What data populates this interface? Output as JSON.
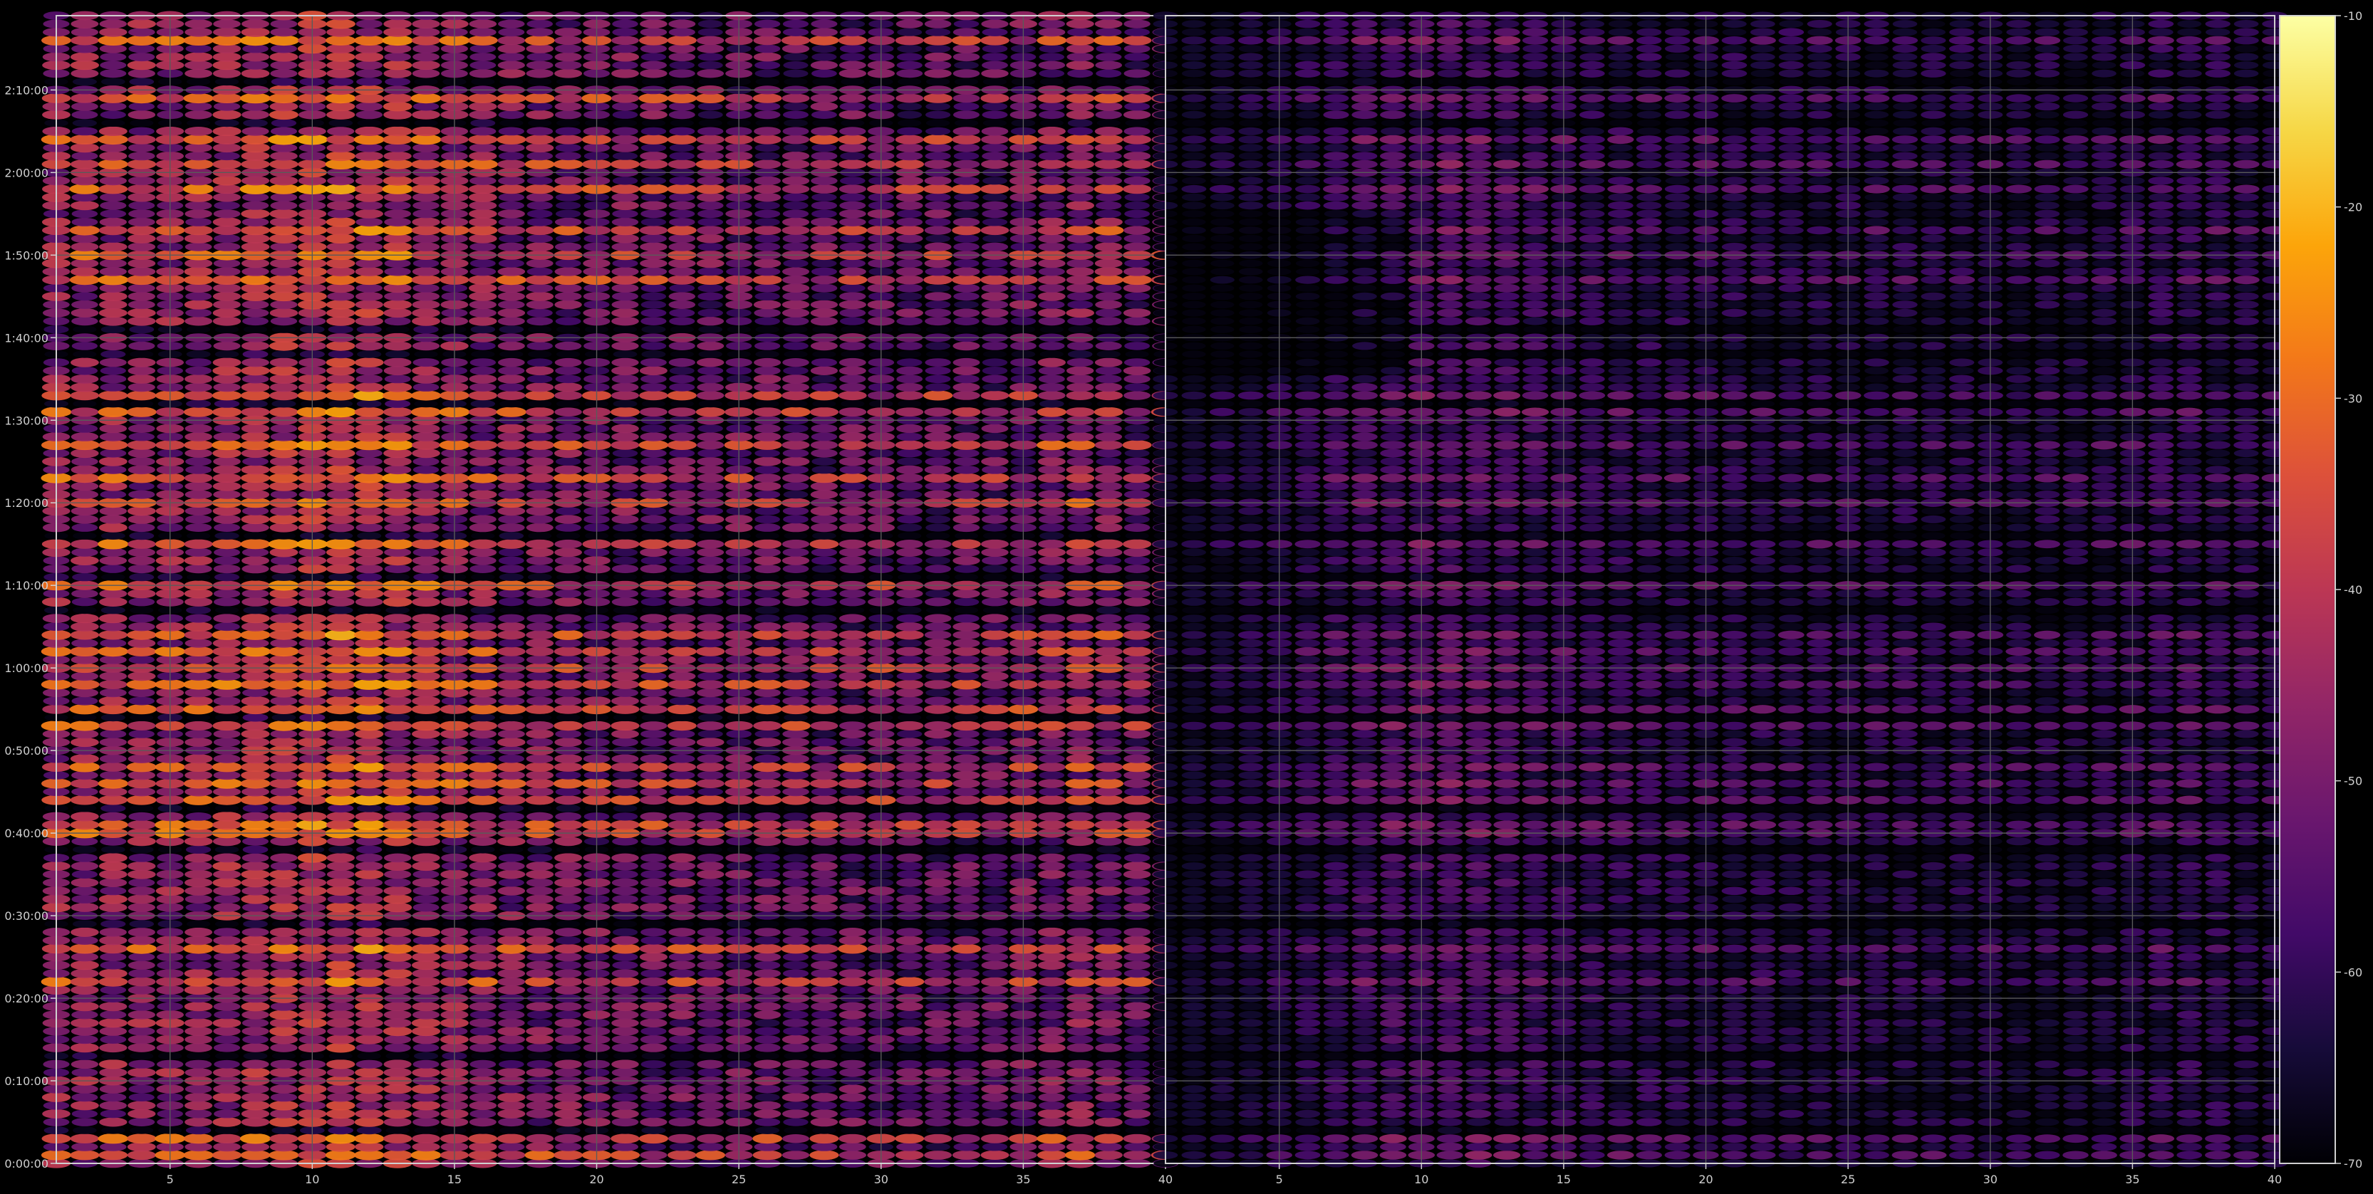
{
  "chart_data": {
    "type": "heatmap",
    "panels": [
      {
        "name": "",
        "x_ticks": [
          "5",
          "10",
          "15",
          "20",
          "25",
          "30",
          "35",
          "40"
        ],
        "x_tick_values": [
          5,
          10,
          15,
          20,
          25,
          30,
          35,
          40
        ],
        "xlim": [
          1,
          40
        ],
        "relative_level": 1.0
      },
      {
        "name": "",
        "x_ticks": [
          "5",
          "10",
          "15",
          "20",
          "25",
          "30",
          "35",
          "40"
        ],
        "x_tick_values": [
          5,
          10,
          15,
          20,
          25,
          30,
          35,
          40
        ],
        "xlim": [
          1,
          40
        ],
        "relative_level": 0.55
      }
    ],
    "y_ticks": [
      "0:00:00",
      "0:10:00",
      "0:20:00",
      "0:30:00",
      "0:40:00",
      "0:50:00",
      "1:00:00",
      "1:10:00",
      "1:20:00",
      "1:30:00",
      "1:40:00",
      "1:50:00",
      "2:00:00",
      "2:10:00"
    ],
    "y_tick_minutes": [
      0,
      10,
      20,
      30,
      40,
      50,
      60,
      70,
      80,
      90,
      100,
      110,
      120,
      130
    ],
    "ylim_minutes": [
      0,
      139
    ],
    "colorbar": {
      "ticks": [
        "-10",
        "-20",
        "-30",
        "-40",
        "-50",
        "-60",
        "-70"
      ],
      "tick_values": [
        -10,
        -20,
        -30,
        -40,
        -50,
        -60,
        -70
      ],
      "range": [
        -70,
        -10
      ],
      "colormap": "inferno"
    },
    "grid": true,
    "bright_rows_minutes": [
      1,
      3,
      22,
      26,
      40,
      41,
      44,
      46,
      48,
      53,
      55,
      58,
      60,
      62,
      64,
      70,
      75,
      80,
      83,
      87,
      91,
      93,
      107,
      110,
      113,
      118,
      121,
      124,
      129,
      136
    ],
    "dark_rows_minutes": [
      4,
      13,
      29,
      38,
      43,
      54,
      67,
      71,
      76,
      92,
      98,
      101,
      126,
      131
    ],
    "colors": {
      "background": "#000000",
      "axes_frame": "#d0d0d0",
      "grid": "#5a5a5a",
      "tick_text": "#cfcfcf"
    }
  }
}
